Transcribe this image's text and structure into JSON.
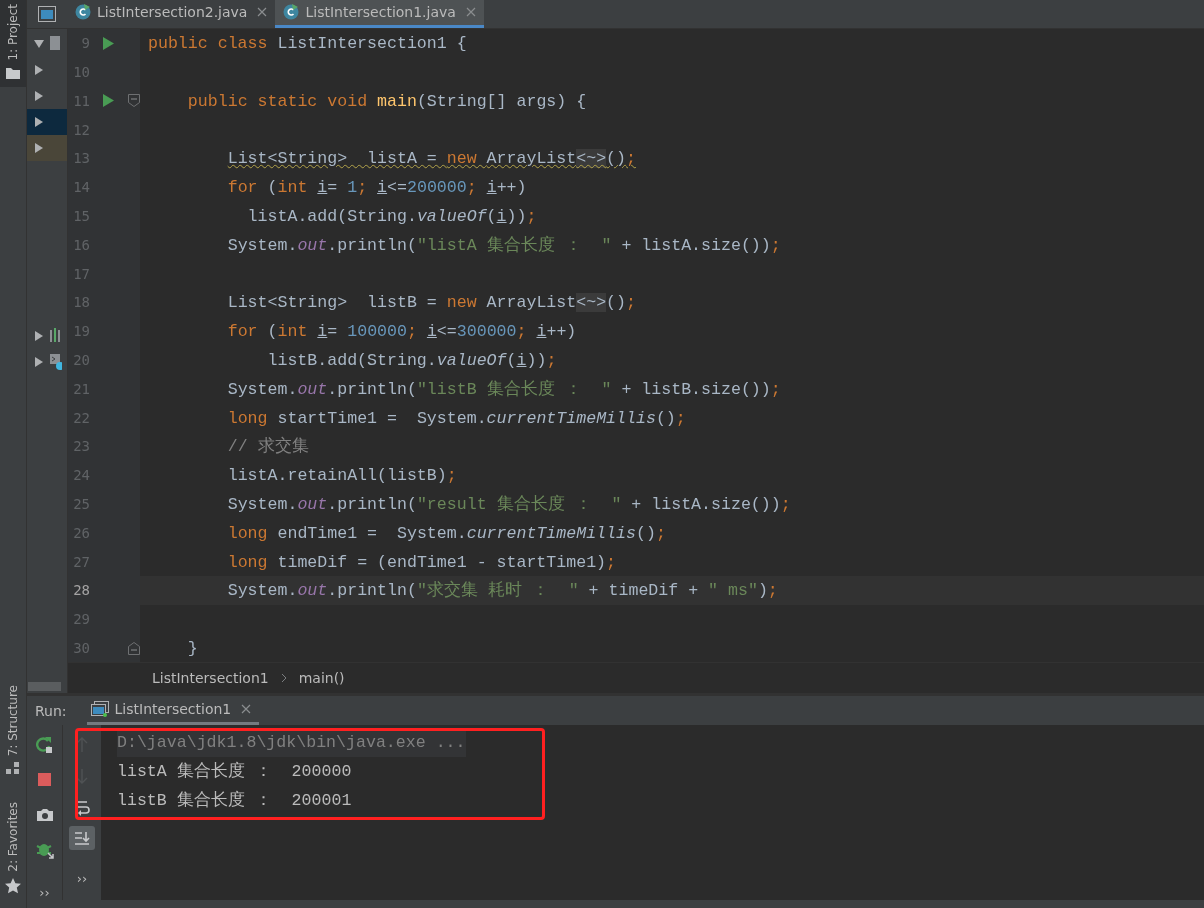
{
  "tool_strip": {
    "top": [
      {
        "label": "1: Project",
        "kind": "folder"
      }
    ],
    "bottom": [
      {
        "label": "7: Structure",
        "kind": "structure"
      },
      {
        "label": "2: Favorites",
        "kind": "star"
      }
    ]
  },
  "tabs": [
    {
      "label": "ListIntersection2.java",
      "selected": false
    },
    {
      "label": "ListIntersection1.java",
      "selected": true
    }
  ],
  "project_tree": {
    "top_rows": [
      {
        "expanded": true,
        "kind": "file"
      },
      {
        "expanded": false
      },
      {
        "expanded": false
      },
      {
        "expanded": false,
        "color": "#0d293e"
      },
      {
        "expanded": false,
        "color": "#4a4639"
      }
    ],
    "lower_rows": [
      {
        "expanded": false,
        "kind": "chart"
      },
      {
        "expanded": false,
        "kind": "console"
      }
    ]
  },
  "editor": {
    "lines": [
      {
        "number": "9",
        "run": true,
        "tokens": [
          {
            "text": "public class ",
            "kind": "keyword"
          },
          {
            "text": "ListIntersection1 {",
            "kind": "plain"
          }
        ]
      },
      {
        "number": "10"
      },
      {
        "number": "11",
        "run": true,
        "fold_start": true,
        "tokens": [
          {
            "text": "    public static void ",
            "kind": "keyword"
          },
          {
            "text": "main",
            "kind": "method"
          },
          {
            "text": "(String[] args) {",
            "kind": "plain"
          }
        ]
      },
      {
        "number": "12"
      },
      {
        "number": "13",
        "warning": true,
        "tokens": [
          {
            "text": "        List<String>  listA = ",
            "kind": "plain"
          },
          {
            "text": "new ",
            "kind": "keyword"
          },
          {
            "text": "ArrayList",
            "kind": "plain"
          },
          {
            "text": "<~>",
            "kind": "folded"
          },
          {
            "text": "()",
            "kind": "plain"
          },
          {
            "text": ";",
            "kind": "keyword"
          }
        ]
      },
      {
        "number": "14",
        "tokens": [
          {
            "text": "        for ",
            "kind": "keyword"
          },
          {
            "text": "(",
            "kind": "plain"
          },
          {
            "text": "int ",
            "kind": "keyword"
          },
          {
            "text": "i",
            "kind": "var"
          },
          {
            "text": "= ",
            "kind": "plain"
          },
          {
            "text": "1",
            "kind": "number"
          },
          {
            "text": "; ",
            "kind": "keyword"
          },
          {
            "text": "i",
            "kind": "var"
          },
          {
            "text": "<=",
            "kind": "plain"
          },
          {
            "text": "200000",
            "kind": "number"
          },
          {
            "text": "; ",
            "kind": "keyword"
          },
          {
            "text": "i",
            "kind": "var"
          },
          {
            "text": "++)",
            "kind": "plain"
          }
        ]
      },
      {
        "number": "15",
        "tokens": [
          {
            "text": "          listA.add(String.",
            "kind": "plain"
          },
          {
            "text": "valueOf",
            "kind": "static"
          },
          {
            "text": "(",
            "kind": "plain"
          },
          {
            "text": "i",
            "kind": "var"
          },
          {
            "text": "))",
            "kind": "plain"
          },
          {
            "text": ";",
            "kind": "keyword"
          }
        ]
      },
      {
        "number": "16",
        "tokens": [
          {
            "text": "        System.",
            "kind": "plain"
          },
          {
            "text": "out",
            "kind": "field"
          },
          {
            "text": ".println(",
            "kind": "plain"
          },
          {
            "text": "\"listA 集合长度 ：  \"",
            "kind": "string"
          },
          {
            "text": " + listA.size())",
            "kind": "plain"
          },
          {
            "text": ";",
            "kind": "keyword"
          }
        ]
      },
      {
        "number": "17"
      },
      {
        "number": "18",
        "tokens": [
          {
            "text": "        List<String>  listB = ",
            "kind": "plain"
          },
          {
            "text": "new ",
            "kind": "keyword"
          },
          {
            "text": "ArrayList",
            "kind": "plain"
          },
          {
            "text": "<~>",
            "kind": "folded"
          },
          {
            "text": "()",
            "kind": "plain"
          },
          {
            "text": ";",
            "kind": "keyword"
          }
        ]
      },
      {
        "number": "19",
        "tokens": [
          {
            "text": "        for ",
            "kind": "keyword"
          },
          {
            "text": "(",
            "kind": "plain"
          },
          {
            "text": "int ",
            "kind": "keyword"
          },
          {
            "text": "i",
            "kind": "var"
          },
          {
            "text": "= ",
            "kind": "plain"
          },
          {
            "text": "100000",
            "kind": "number"
          },
          {
            "text": "; ",
            "kind": "keyword"
          },
          {
            "text": "i",
            "kind": "var"
          },
          {
            "text": "<=",
            "kind": "plain"
          },
          {
            "text": "300000",
            "kind": "number"
          },
          {
            "text": "; ",
            "kind": "keyword"
          },
          {
            "text": "i",
            "kind": "var"
          },
          {
            "text": "++)",
            "kind": "plain"
          }
        ]
      },
      {
        "number": "20",
        "tokens": [
          {
            "text": "            listB.add(String.",
            "kind": "plain"
          },
          {
            "text": "valueOf",
            "kind": "static"
          },
          {
            "text": "(",
            "kind": "plain"
          },
          {
            "text": "i",
            "kind": "var"
          },
          {
            "text": "))",
            "kind": "plain"
          },
          {
            "text": ";",
            "kind": "keyword"
          }
        ]
      },
      {
        "number": "21",
        "tokens": [
          {
            "text": "        System.",
            "kind": "plain"
          },
          {
            "text": "out",
            "kind": "field"
          },
          {
            "text": ".println(",
            "kind": "plain"
          },
          {
            "text": "\"listB 集合长度 ：  \"",
            "kind": "string"
          },
          {
            "text": " + listB.size())",
            "kind": "plain"
          },
          {
            "text": ";",
            "kind": "keyword"
          }
        ]
      },
      {
        "number": "22",
        "tokens": [
          {
            "text": "        long ",
            "kind": "keyword"
          },
          {
            "text": "startTime1 =  System.",
            "kind": "plain"
          },
          {
            "text": "currentTimeMillis",
            "kind": "static"
          },
          {
            "text": "()",
            "kind": "plain"
          },
          {
            "text": ";",
            "kind": "keyword"
          }
        ]
      },
      {
        "number": "23",
        "tokens": [
          {
            "text": "        // 求交集",
            "kind": "comment"
          }
        ]
      },
      {
        "number": "24",
        "tokens": [
          {
            "text": "        listA.retainAll(listB)",
            "kind": "plain"
          },
          {
            "text": ";",
            "kind": "keyword"
          }
        ]
      },
      {
        "number": "25",
        "tokens": [
          {
            "text": "        System.",
            "kind": "plain"
          },
          {
            "text": "out",
            "kind": "field"
          },
          {
            "text": ".println(",
            "kind": "plain"
          },
          {
            "text": "\"result 集合长度 ：  \"",
            "kind": "string"
          },
          {
            "text": " + listA.size())",
            "kind": "plain"
          },
          {
            "text": ";",
            "kind": "keyword"
          }
        ]
      },
      {
        "number": "26",
        "tokens": [
          {
            "text": "        long ",
            "kind": "keyword"
          },
          {
            "text": "endTime1 =  System.",
            "kind": "plain"
          },
          {
            "text": "currentTimeMillis",
            "kind": "static"
          },
          {
            "text": "()",
            "kind": "plain"
          },
          {
            "text": ";",
            "kind": "keyword"
          }
        ]
      },
      {
        "number": "27",
        "tokens": [
          {
            "text": "        long ",
            "kind": "keyword"
          },
          {
            "text": "timeDif = (endTime1 - startTime1)",
            "kind": "plain"
          },
          {
            "text": ";",
            "kind": "keyword"
          }
        ]
      },
      {
        "number": "28",
        "current": true,
        "tokens": [
          {
            "text": "        System.",
            "kind": "plain"
          },
          {
            "text": "out",
            "kind": "field"
          },
          {
            "text": ".println(",
            "kind": "plain"
          },
          {
            "text": "\"求交集 耗时 ：  \"",
            "kind": "string"
          },
          {
            "text": " + timeDif + ",
            "kind": "plain"
          },
          {
            "text": "\" ms\"",
            "kind": "string"
          },
          {
            "text": ")",
            "kind": "plain"
          },
          {
            "text": ";",
            "kind": "keyword"
          }
        ]
      },
      {
        "number": "29"
      },
      {
        "number": "30",
        "fold_end": true,
        "tokens": [
          {
            "text": "    }",
            "kind": "plain"
          }
        ]
      }
    ]
  },
  "breadcrumbs": [
    "ListIntersection1",
    "main()"
  ],
  "run_panel": {
    "label": "Run:",
    "tab": {
      "label": "ListIntersection1",
      "selected": true
    },
    "toolbar": [
      {
        "kind": "rerun"
      },
      {
        "kind": "stop"
      },
      {
        "kind": "camera"
      },
      {
        "kind": "debug"
      },
      {
        "kind": "more",
        "text": "››"
      }
    ],
    "console_toolbar": [
      {
        "kind": "up",
        "disabled": true,
        "selected": false
      },
      {
        "kind": "down",
        "disabled": true,
        "selected": false
      },
      {
        "kind": "wrap",
        "disabled": false,
        "selected": false
      },
      {
        "kind": "scroll_end",
        "disabled": false,
        "selected": true
      },
      {
        "kind": "more",
        "text": "››"
      }
    ],
    "console": [
      {
        "kind": "command",
        "text": "D:\\java\\jdk1.8\\jdk\\bin\\java.exe ..."
      },
      {
        "kind": "output",
        "text": "listA 集合长度 ：  200000"
      },
      {
        "kind": "output",
        "text": "listB 集合长度 ：  200001"
      }
    ],
    "annotation": {
      "kind": "rectangle",
      "color": "#ff2020"
    }
  }
}
